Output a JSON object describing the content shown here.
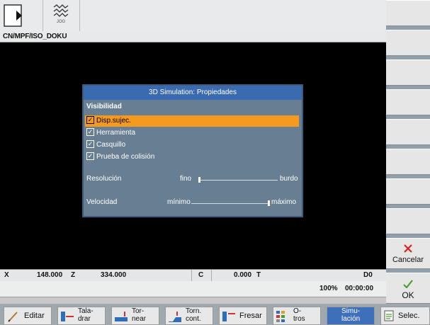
{
  "header": {
    "mode_icon": "machine-mode-icon",
    "jog_icon": "jog-icon",
    "jog_label": "JOG",
    "program_path": "CN/MPF/ISO_DOKU"
  },
  "dialog": {
    "title": "3D Simulation: Propiedades",
    "section_visibility": "Visibilidad",
    "options": [
      {
        "label": "Disp.sujec.",
        "checked": true,
        "selected": true
      },
      {
        "label": "Herramienta",
        "checked": true,
        "selected": false
      },
      {
        "label": "Casquillo",
        "checked": true,
        "selected": false
      },
      {
        "label": "Prueba de colisión",
        "checked": true,
        "selected": false
      }
    ],
    "resolution": {
      "label": "Resolución",
      "min": "fino",
      "max": "burdo",
      "level": 0.0
    },
    "speed": {
      "label": "Velocidad",
      "min": "mínimo",
      "max": "máximo",
      "level": 1.0
    }
  },
  "status": {
    "x_label": "X",
    "x_value": "148.000",
    "z_label": "Z",
    "z_value": "334.000",
    "c_label": "C",
    "c_value": "0.000",
    "t_label": "T",
    "d_label": "D0",
    "feed_override": "100%",
    "time": "00:00:00"
  },
  "vertical_softkeys": {
    "cancel": "Cancelar",
    "ok": "OK"
  },
  "horizontal_softkeys": [
    {
      "line1": "Editar",
      "line2": "",
      "icon": "edit-icon",
      "active": false
    },
    {
      "line1": "Tala-",
      "line2": "drar",
      "icon": "drilling-icon",
      "active": false
    },
    {
      "line1": "Tor-",
      "line2": "near",
      "icon": "turning-icon",
      "active": false
    },
    {
      "line1": "Torn.",
      "line2": "cont.",
      "icon": "contour-turning-icon",
      "active": false
    },
    {
      "line1": "Fresar",
      "line2": "",
      "icon": "milling-icon",
      "active": false
    },
    {
      "line1": "O-",
      "line2": "tros",
      "icon": "others-icon",
      "active": false
    },
    {
      "line1": "Simu-",
      "line2": "lación",
      "icon": "",
      "active": true
    },
    {
      "line1": "Selec.",
      "line2": "",
      "icon": "select-icon",
      "active": false
    }
  ],
  "colors": {
    "accent": "#3d6fba",
    "selection": "#f39a1f",
    "cancel": "#e02020",
    "ok": "#4aa02a"
  }
}
